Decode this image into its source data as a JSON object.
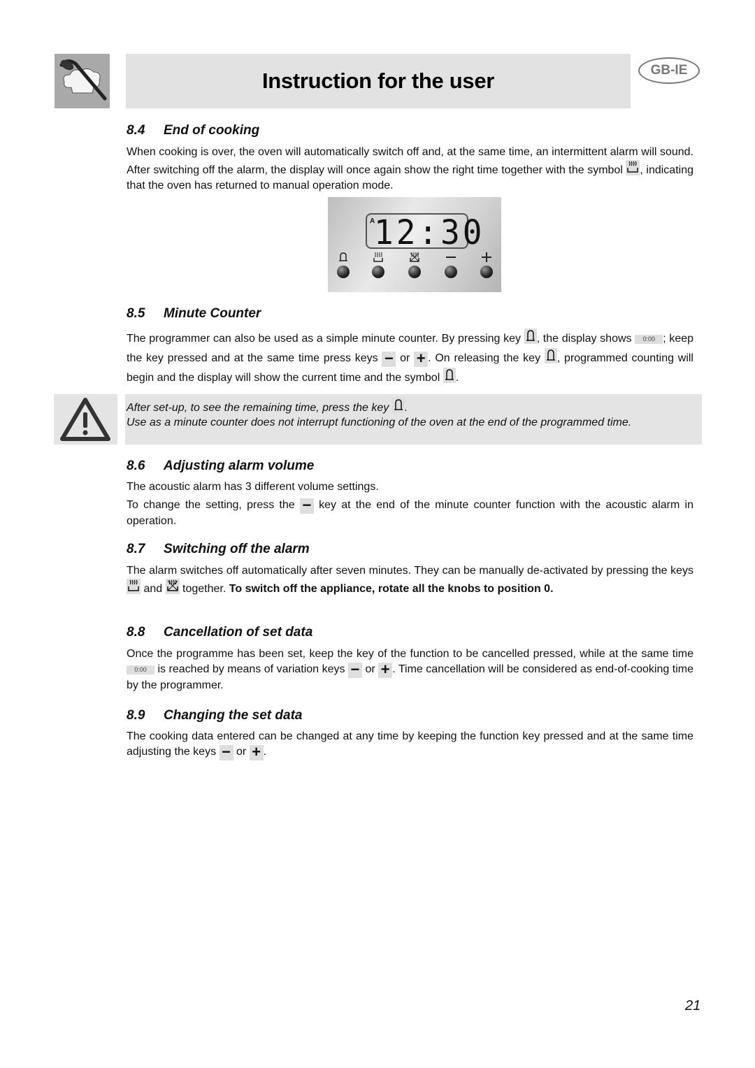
{
  "header": {
    "title": "Instruction for the user",
    "region_badge": "GB-IE",
    "logo_icon": "chef-hat-spoon-icon"
  },
  "sections": {
    "s84": {
      "number": "8.4",
      "title": "End of cooking",
      "text_1": "When cooking is over, the oven will automatically switch off and, at the same time, an intermittent alarm will sound. After switching off the alarm, the display will once again show the right time together with the symbol ",
      "text_2": ", indicating that the oven has returned to manual operation mode."
    },
    "panel": {
      "indicator": "A",
      "time": "12:30",
      "buttons": [
        {
          "label": "bell",
          "icon": "bell-icon"
        },
        {
          "label": "cooking",
          "icon": "heat-icon"
        },
        {
          "label": "end-cooking",
          "icon": "heat-crossed-icon"
        },
        {
          "label": "−",
          "icon": "minus-icon"
        },
        {
          "label": "+",
          "icon": "plus-icon"
        }
      ]
    },
    "s85": {
      "number": "8.5",
      "title": "Minute Counter",
      "t1": "The programmer can also be used as a simple minute counter. By pressing key ",
      "t2": ", the display shows ",
      "zero_display": "0:00",
      "t3": "; keep the key pressed and at the same time press keys ",
      "or": " or ",
      "t4": ". On releasing the key ",
      "t5": ", programmed counting will begin and the display will show the current time and the symbol ",
      "t6": "."
    },
    "warning": {
      "line1_a": "After set-up, to see the remaining time, press the key ",
      "line1_b": ".",
      "line2": "Use as a minute counter does not interrupt functioning of the oven at the end of the programmed time."
    },
    "s86": {
      "number": "8.6",
      "title": "Adjusting alarm volume",
      "p1": "The acoustic alarm has 3 different volume settings.",
      "p2_a": "To change the setting, press the ",
      "p2_b": " key at the end of the minute counter function with the acoustic alarm in operation."
    },
    "s87": {
      "number": "8.7",
      "title": "Switching off the alarm",
      "t1": "The alarm switches off automatically after seven minutes. They can be manually de-activated by pressing the keys ",
      "and": " and ",
      "t2": " together. ",
      "bold": "To switch off the appliance, rotate all the knobs to position 0."
    },
    "s88": {
      "number": "8.8",
      "title": "Cancellation of set data",
      "t1": "Once the programme has been set, keep the key of the function to be cancelled pressed, while at the same time ",
      "zero_display": "0:00",
      "t2": " is reached by means of variation keys ",
      "or": " or ",
      "t3": ". Time cancellation will be considered as end-of-cooking time by the programmer."
    },
    "s89": {
      "number": "8.9",
      "title": "Changing the set data",
      "t1": "The cooking data entered can be changed at any time by keeping the function key pressed and at the same time adjusting the keys ",
      "or": " or ",
      "t2": "."
    }
  },
  "footer": {
    "page_number": "21"
  }
}
